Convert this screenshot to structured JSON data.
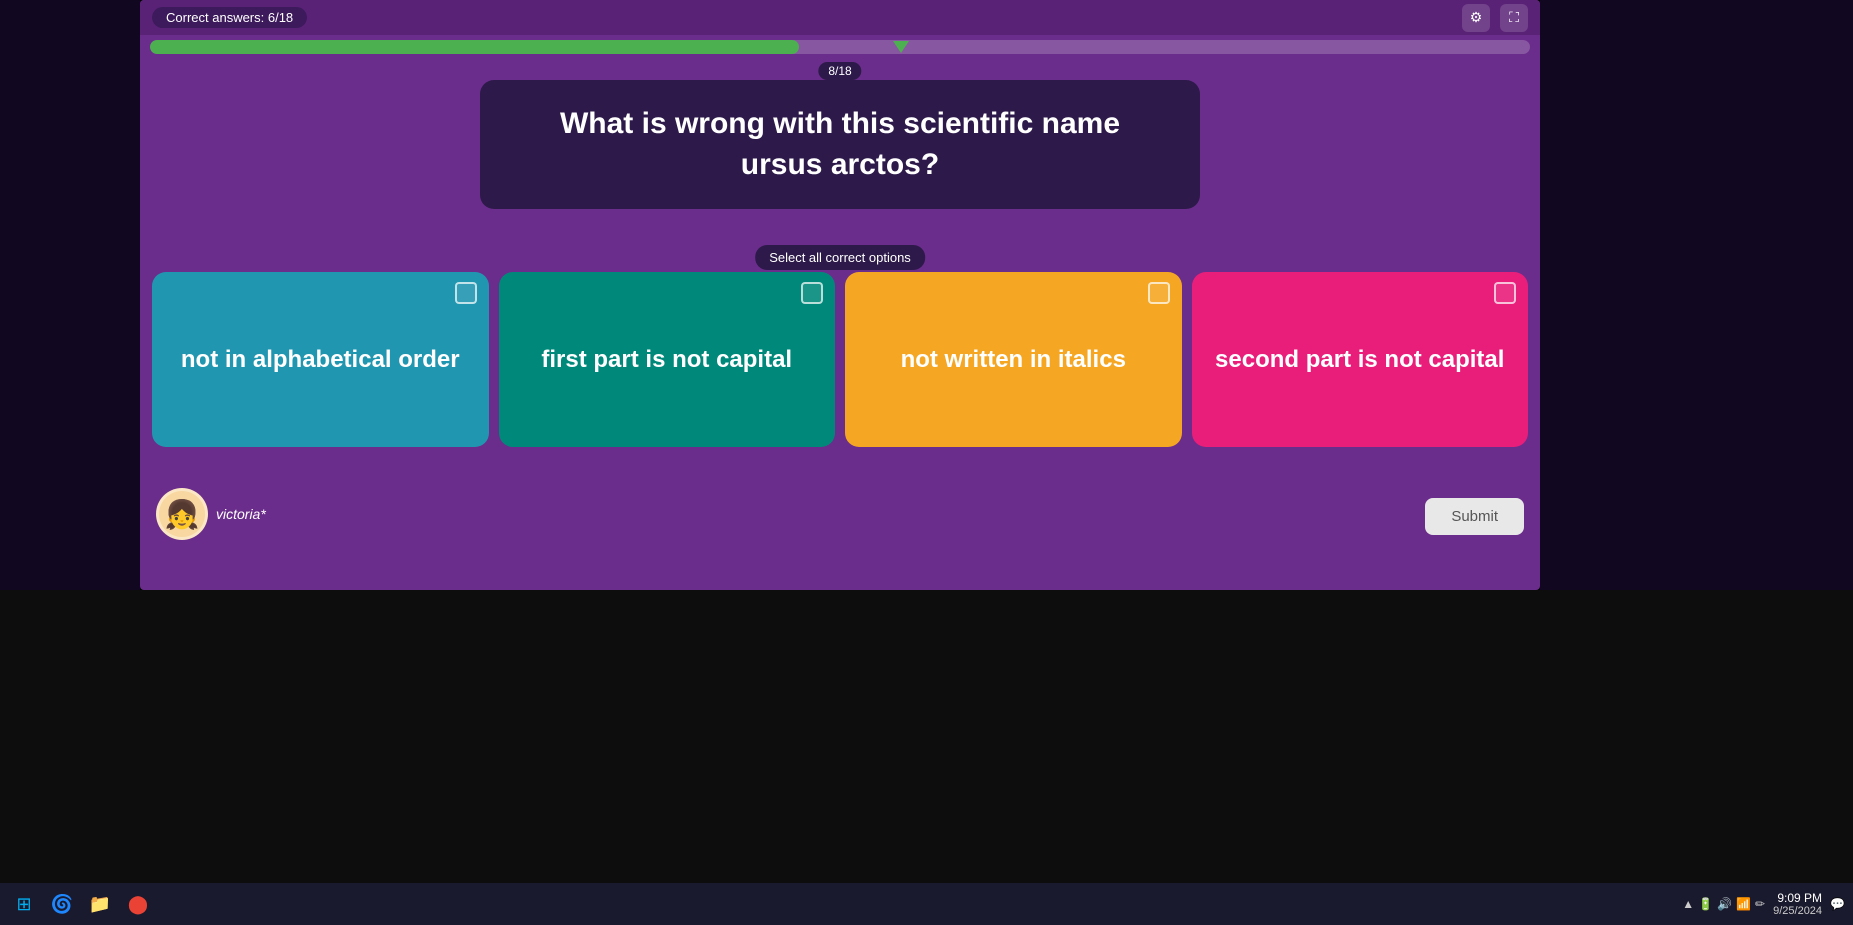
{
  "header": {
    "correct_answers": "Correct answers: 6/18",
    "progress_counter": "8/18"
  },
  "question": {
    "text": "What is wrong with this scientific name ursus arctos?"
  },
  "instruction": {
    "label": "Select all correct options"
  },
  "options": [
    {
      "id": "opt1",
      "text": "not in alphabetical order",
      "color_class": "option-blue"
    },
    {
      "id": "opt2",
      "text": "first part is not capital",
      "color_class": "option-teal"
    },
    {
      "id": "opt3",
      "text": "not written in italics",
      "color_class": "option-orange"
    },
    {
      "id": "opt4",
      "text": "second part is not capital",
      "color_class": "option-pink"
    }
  ],
  "user": {
    "name": "victoria*"
  },
  "buttons": {
    "submit": "Submit"
  },
  "taskbar": {
    "icons": [
      "⊞",
      "🌐",
      "📁",
      "🔵"
    ],
    "time": "9:09 PM",
    "date": "9/25/2024"
  },
  "icons": {
    "settings": "⚙",
    "fullscreen": "⛶"
  }
}
